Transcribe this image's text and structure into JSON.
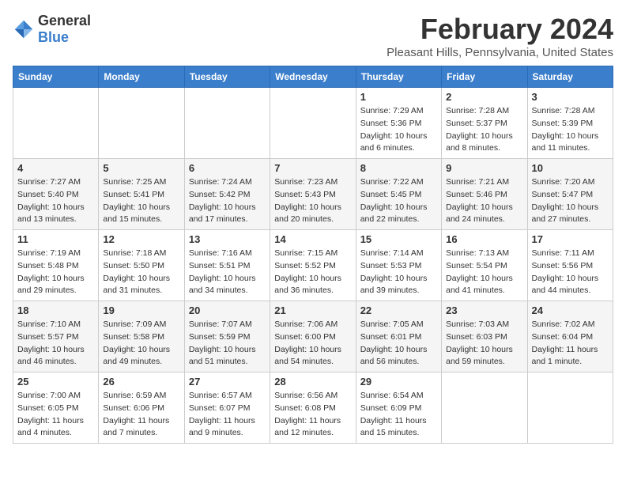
{
  "header": {
    "logo_general": "General",
    "logo_blue": "Blue",
    "month_year": "February 2024",
    "location": "Pleasant Hills, Pennsylvania, United States"
  },
  "days_of_week": [
    "Sunday",
    "Monday",
    "Tuesday",
    "Wednesday",
    "Thursday",
    "Friday",
    "Saturday"
  ],
  "weeks": [
    [
      {
        "day": "",
        "detail": ""
      },
      {
        "day": "",
        "detail": ""
      },
      {
        "day": "",
        "detail": ""
      },
      {
        "day": "",
        "detail": ""
      },
      {
        "day": "1",
        "detail": "Sunrise: 7:29 AM\nSunset: 5:36 PM\nDaylight: 10 hours\nand 6 minutes."
      },
      {
        "day": "2",
        "detail": "Sunrise: 7:28 AM\nSunset: 5:37 PM\nDaylight: 10 hours\nand 8 minutes."
      },
      {
        "day": "3",
        "detail": "Sunrise: 7:28 AM\nSunset: 5:39 PM\nDaylight: 10 hours\nand 11 minutes."
      }
    ],
    [
      {
        "day": "4",
        "detail": "Sunrise: 7:27 AM\nSunset: 5:40 PM\nDaylight: 10 hours\nand 13 minutes."
      },
      {
        "day": "5",
        "detail": "Sunrise: 7:25 AM\nSunset: 5:41 PM\nDaylight: 10 hours\nand 15 minutes."
      },
      {
        "day": "6",
        "detail": "Sunrise: 7:24 AM\nSunset: 5:42 PM\nDaylight: 10 hours\nand 17 minutes."
      },
      {
        "day": "7",
        "detail": "Sunrise: 7:23 AM\nSunset: 5:43 PM\nDaylight: 10 hours\nand 20 minutes."
      },
      {
        "day": "8",
        "detail": "Sunrise: 7:22 AM\nSunset: 5:45 PM\nDaylight: 10 hours\nand 22 minutes."
      },
      {
        "day": "9",
        "detail": "Sunrise: 7:21 AM\nSunset: 5:46 PM\nDaylight: 10 hours\nand 24 minutes."
      },
      {
        "day": "10",
        "detail": "Sunrise: 7:20 AM\nSunset: 5:47 PM\nDaylight: 10 hours\nand 27 minutes."
      }
    ],
    [
      {
        "day": "11",
        "detail": "Sunrise: 7:19 AM\nSunset: 5:48 PM\nDaylight: 10 hours\nand 29 minutes."
      },
      {
        "day": "12",
        "detail": "Sunrise: 7:18 AM\nSunset: 5:50 PM\nDaylight: 10 hours\nand 31 minutes."
      },
      {
        "day": "13",
        "detail": "Sunrise: 7:16 AM\nSunset: 5:51 PM\nDaylight: 10 hours\nand 34 minutes."
      },
      {
        "day": "14",
        "detail": "Sunrise: 7:15 AM\nSunset: 5:52 PM\nDaylight: 10 hours\nand 36 minutes."
      },
      {
        "day": "15",
        "detail": "Sunrise: 7:14 AM\nSunset: 5:53 PM\nDaylight: 10 hours\nand 39 minutes."
      },
      {
        "day": "16",
        "detail": "Sunrise: 7:13 AM\nSunset: 5:54 PM\nDaylight: 10 hours\nand 41 minutes."
      },
      {
        "day": "17",
        "detail": "Sunrise: 7:11 AM\nSunset: 5:56 PM\nDaylight: 10 hours\nand 44 minutes."
      }
    ],
    [
      {
        "day": "18",
        "detail": "Sunrise: 7:10 AM\nSunset: 5:57 PM\nDaylight: 10 hours\nand 46 minutes."
      },
      {
        "day": "19",
        "detail": "Sunrise: 7:09 AM\nSunset: 5:58 PM\nDaylight: 10 hours\nand 49 minutes."
      },
      {
        "day": "20",
        "detail": "Sunrise: 7:07 AM\nSunset: 5:59 PM\nDaylight: 10 hours\nand 51 minutes."
      },
      {
        "day": "21",
        "detail": "Sunrise: 7:06 AM\nSunset: 6:00 PM\nDaylight: 10 hours\nand 54 minutes."
      },
      {
        "day": "22",
        "detail": "Sunrise: 7:05 AM\nSunset: 6:01 PM\nDaylight: 10 hours\nand 56 minutes."
      },
      {
        "day": "23",
        "detail": "Sunrise: 7:03 AM\nSunset: 6:03 PM\nDaylight: 10 hours\nand 59 minutes."
      },
      {
        "day": "24",
        "detail": "Sunrise: 7:02 AM\nSunset: 6:04 PM\nDaylight: 11 hours\nand 1 minute."
      }
    ],
    [
      {
        "day": "25",
        "detail": "Sunrise: 7:00 AM\nSunset: 6:05 PM\nDaylight: 11 hours\nand 4 minutes."
      },
      {
        "day": "26",
        "detail": "Sunrise: 6:59 AM\nSunset: 6:06 PM\nDaylight: 11 hours\nand 7 minutes."
      },
      {
        "day": "27",
        "detail": "Sunrise: 6:57 AM\nSunset: 6:07 PM\nDaylight: 11 hours\nand 9 minutes."
      },
      {
        "day": "28",
        "detail": "Sunrise: 6:56 AM\nSunset: 6:08 PM\nDaylight: 11 hours\nand 12 minutes."
      },
      {
        "day": "29",
        "detail": "Sunrise: 6:54 AM\nSunset: 6:09 PM\nDaylight: 11 hours\nand 15 minutes."
      },
      {
        "day": "",
        "detail": ""
      },
      {
        "day": "",
        "detail": ""
      }
    ]
  ]
}
